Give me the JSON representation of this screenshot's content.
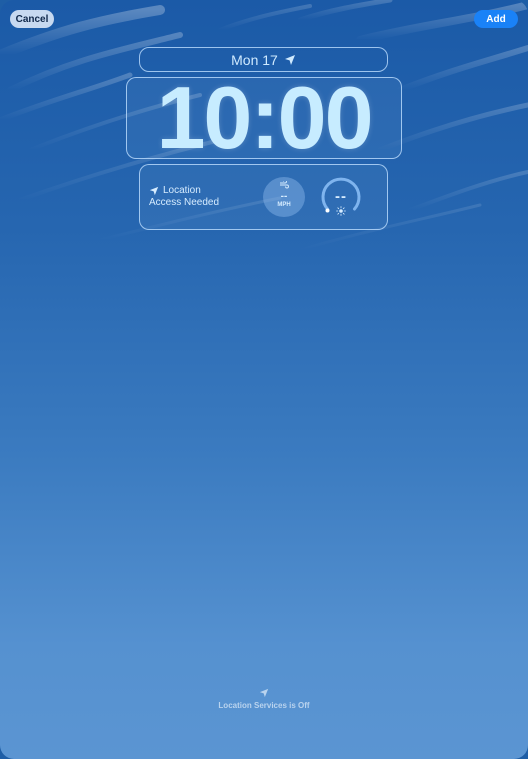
{
  "toolbar": {
    "cancel_label": "Cancel",
    "add_label": "Add"
  },
  "lock_screen": {
    "date_text": "Mon 17",
    "time_text": "10:00"
  },
  "widgets": {
    "location": {
      "line1": "Location",
      "line2": "Access Needed"
    },
    "wind": {
      "value": "--",
      "unit": "MPH"
    },
    "uv": {
      "value": "--"
    }
  },
  "footer": {
    "text": "Location Services is Off"
  },
  "colors": {
    "accent": "#1a82f7",
    "widget_text": "#cfeaff",
    "background_top": "#1b5aa7",
    "background_bottom": "#5b95d2"
  },
  "icons": {
    "date": "location-arrow-icon",
    "location": "location-arrow-icon",
    "wind": "wind-icon",
    "uv": "sun-icon",
    "footer": "location-arrow-icon"
  }
}
